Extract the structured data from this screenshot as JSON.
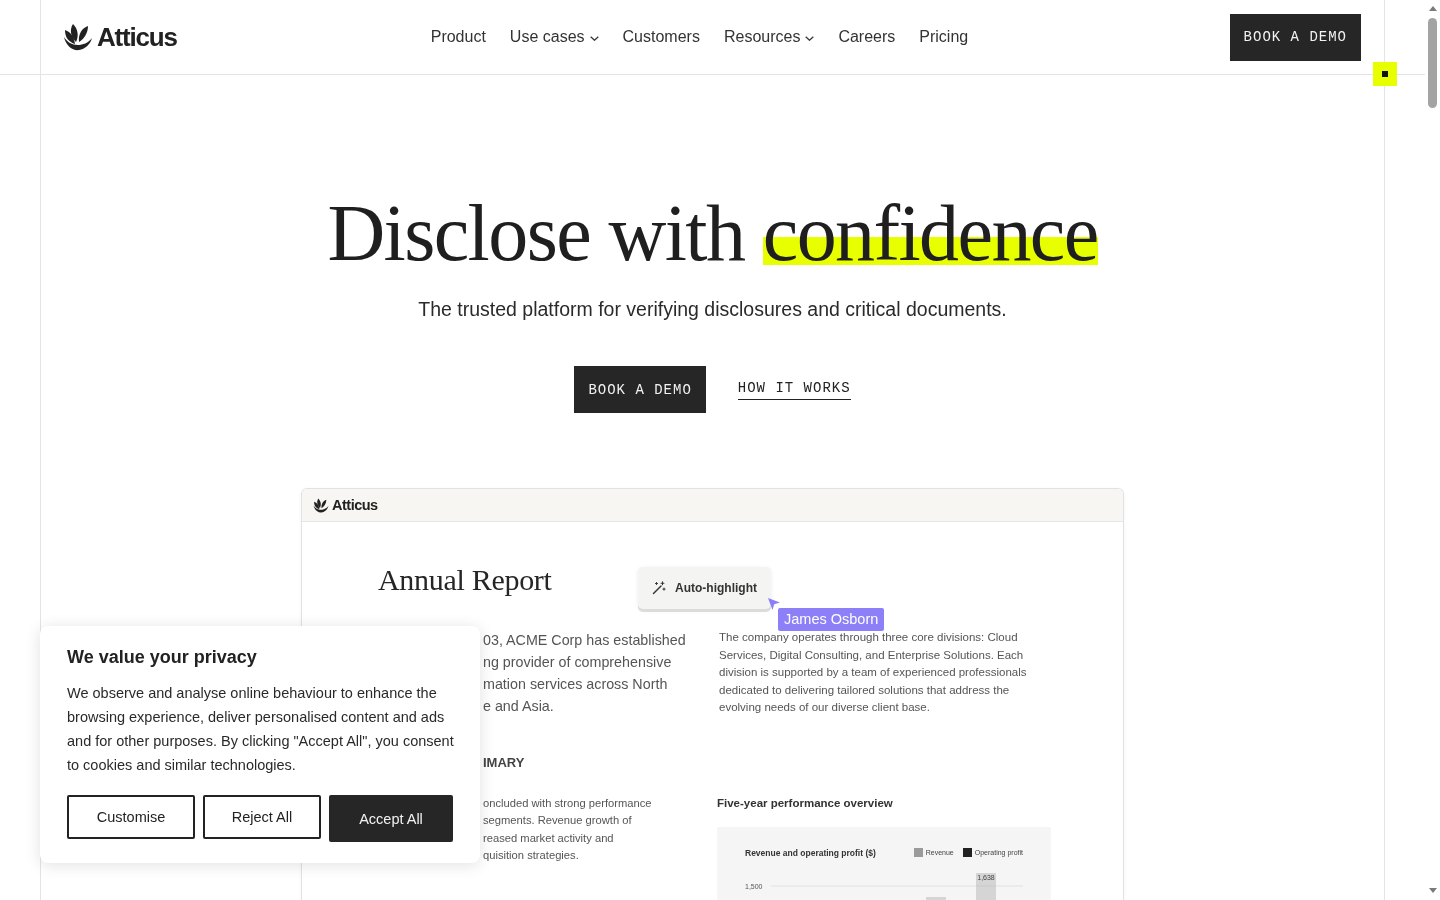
{
  "header": {
    "logo": "Atticus",
    "nav": [
      {
        "label": "Product",
        "dropdown": false
      },
      {
        "label": "Use cases",
        "dropdown": true
      },
      {
        "label": "Customers",
        "dropdown": false
      },
      {
        "label": "Resources",
        "dropdown": true
      },
      {
        "label": "Careers",
        "dropdown": false
      },
      {
        "label": "Pricing",
        "dropdown": false
      }
    ],
    "cta": "BOOK A DEMO"
  },
  "hero": {
    "heading": [
      {
        "text": "Disclose with",
        "highlighted": false
      },
      {
        "text": "confidence",
        "highlighted": true
      }
    ],
    "subtitle": "The trusted platform for verifying disclosures and critical documents.",
    "buttons": [
      {
        "label": "BOOK A DEMO",
        "kind": "solid"
      },
      {
        "label": "HOW IT WORKS",
        "kind": "link"
      }
    ]
  },
  "product_preview": {
    "app_name": "Atticus",
    "document_title": "Annual Report",
    "toolbar_button": "Auto-highlight",
    "collaborator": "James Osborn",
    "left_column": {
      "paragraph_lines": [
        "03, ACME Corp has established",
        "ng provider of comprehensive",
        "mation services across North",
        "e and Asia."
      ],
      "section_heading": "IMARY",
      "section_lines": [
        "oncluded with strong performance",
        "segments. Revenue growth of",
        "reased market activity and",
        "quisition strategies."
      ]
    },
    "right_column": {
      "paragraph": "The company operates through three core divisions: Cloud Services, Digital Consulting, and Enterprise Solutions. Each division is supported by a team of experienced professionals dedicated to delivering tailored solutions that address the evolving needs of our diverse client base.",
      "chart_heading": "Five-year performance overview",
      "chart": {
        "title": "Revenue and operating profit ($)",
        "legend": [
          {
            "name": "Revenue",
            "color": "#9b9b9b"
          },
          {
            "name": "Operating profit",
            "color": "#222222"
          }
        ],
        "gridline_label": "1,500",
        "bar_label": "1,638"
      }
    }
  },
  "cookie_banner": {
    "title": "We value your privacy",
    "text": "We observe and analyse online behaviour to enhance the browsing experience, deliver personalised content and ads and for other purposes. By clicking \"Accept All\", you consent to cookies and similar technologies.",
    "buttons": [
      {
        "label": "Customise",
        "kind": "outline"
      },
      {
        "label": "Reject All",
        "kind": "outline"
      },
      {
        "label": "Accept All",
        "kind": "solid"
      }
    ]
  }
}
